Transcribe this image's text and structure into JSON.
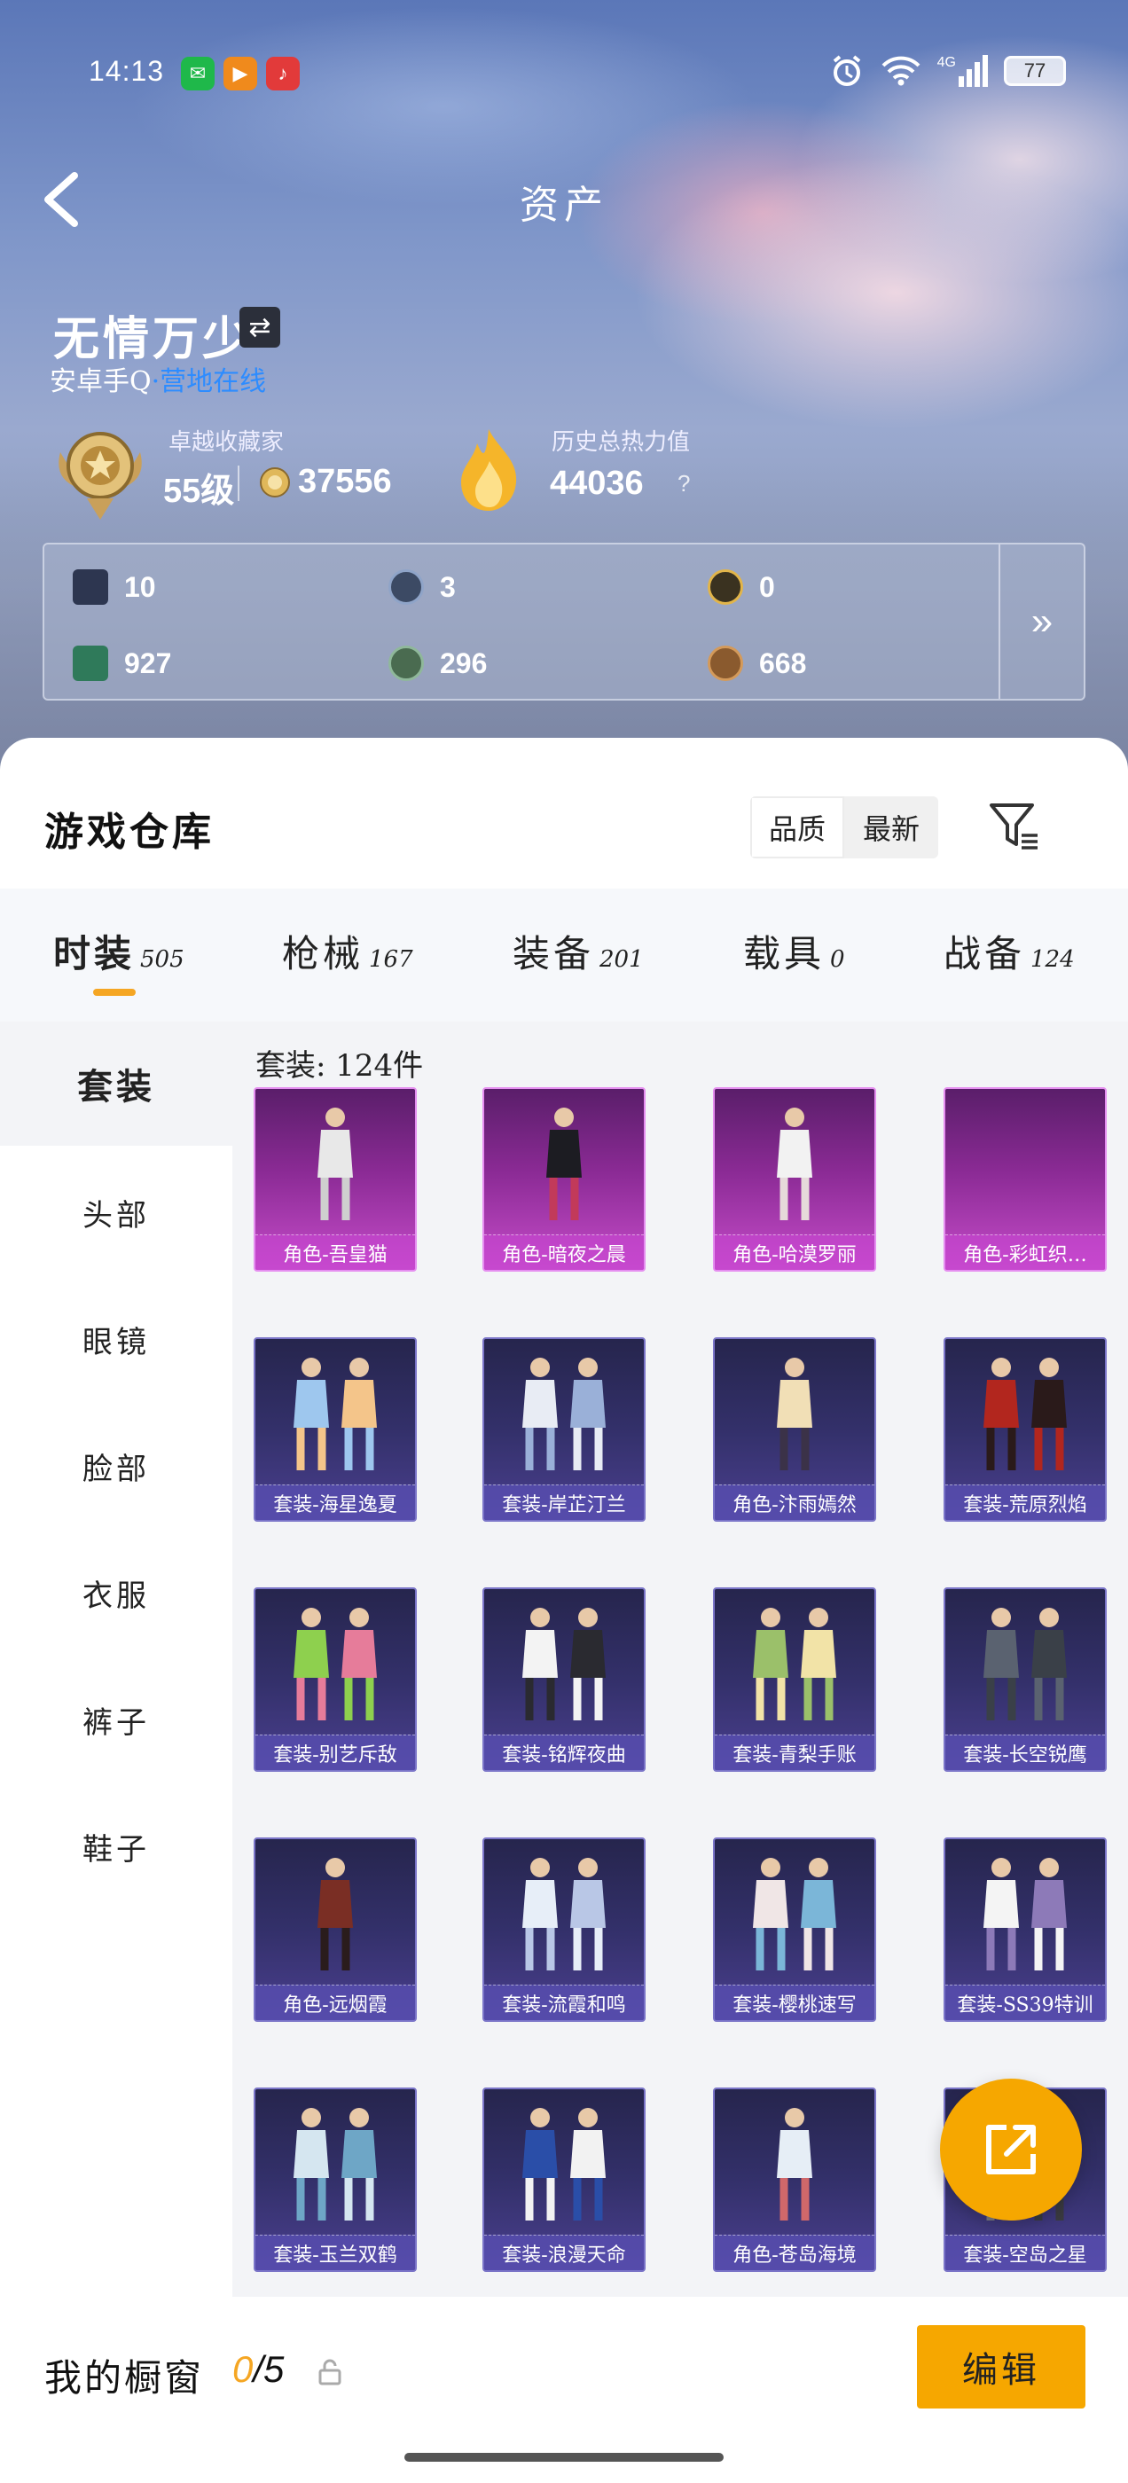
{
  "status_bar": {
    "time": "14:13",
    "network": "4G",
    "battery": "77"
  },
  "nav": {
    "title": "资产"
  },
  "player": {
    "name": "无情万少",
    "platform": "安卓手Q",
    "status": "·营地在线"
  },
  "stats": {
    "level_title": "卓越收藏家",
    "level": "55级",
    "points": "37556",
    "heat_title": "历史总热力值",
    "heat": "44036",
    "help": "?"
  },
  "stat_panel": {
    "row1": [
      "10",
      "3",
      "0"
    ],
    "row2": [
      "927",
      "296",
      "668"
    ],
    "more": "»"
  },
  "warehouse": {
    "title": "游戏仓库",
    "sort": [
      "品质",
      "最新"
    ]
  },
  "tabs": [
    {
      "label": "时装",
      "count": "505"
    },
    {
      "label": "枪械",
      "count": "167"
    },
    {
      "label": "装备",
      "count": "201"
    },
    {
      "label": "载具",
      "count": "0"
    },
    {
      "label": "战备",
      "count": "124"
    }
  ],
  "side_nav": [
    "套装",
    "头部",
    "眼镜",
    "脸部",
    "衣服",
    "裤子",
    "鞋子"
  ],
  "grid": {
    "count_label": "套装: 124件",
    "items": [
      {
        "name": "角色-吾皇猫",
        "colors": [
          "#e8e8e8",
          "#cfcfcf"
        ]
      },
      {
        "name": "角色-暗夜之晨",
        "colors": [
          "#1c1c22",
          "#c23a5a"
        ]
      },
      {
        "name": "角色-哈漠罗丽",
        "colors": [
          "#f2f2f2",
          "#e6dada"
        ]
      },
      {
        "name": "角色-彩虹织…",
        "colors": [
          "#6a2a7a",
          "#6a2a7a"
        ]
      },
      {
        "name": "套装-海星逸夏",
        "colors": [
          "#9ec7ee",
          "#f4c58a"
        ]
      },
      {
        "name": "套装-岸芷汀兰",
        "colors": [
          "#e8ecf4",
          "#9ab0d8"
        ]
      },
      {
        "name": "角色-汴雨嫣然",
        "colors": [
          "#f1dfb6",
          "#3b3248"
        ]
      },
      {
        "name": "套装-荒原烈焰",
        "colors": [
          "#b2261e",
          "#2a1a1a"
        ]
      },
      {
        "name": "套装-别艺斥敌",
        "colors": [
          "#8ed04e",
          "#e67c9a"
        ]
      },
      {
        "name": "套装-铭辉夜曲",
        "colors": [
          "#f3f3f3",
          "#2a2a30"
        ]
      },
      {
        "name": "套装-青梨手账",
        "colors": [
          "#9bc06a",
          "#f2e3a7"
        ]
      },
      {
        "name": "套装-长空锐鹰",
        "colors": [
          "#5a6270",
          "#3a4048"
        ]
      },
      {
        "name": "角色-远烟霞",
        "colors": [
          "#7a2e24",
          "#2a1c1c"
        ]
      },
      {
        "name": "套装-流霞和鸣",
        "colors": [
          "#e7eef8",
          "#b9c7e6"
        ]
      },
      {
        "name": "套装-樱桃速写",
        "colors": [
          "#f0e6e6",
          "#7bb6d8"
        ]
      },
      {
        "name": "套装-SS39特训",
        "colors": [
          "#f4f4f4",
          "#8d7ab8"
        ]
      },
      {
        "name": "套装-玉兰双鹤",
        "colors": [
          "#d5e6f0",
          "#6ea6c6"
        ]
      },
      {
        "name": "套装-浪漫天命",
        "colors": [
          "#2a4ea8",
          "#f2f2f2"
        ]
      },
      {
        "name": "角色-苍岛海境",
        "colors": [
          "#e6eef6",
          "#d0686a"
        ]
      },
      {
        "name": "套装-空岛之星",
        "colors": [
          "#3a3a40",
          "#7a7a80"
        ]
      }
    ]
  },
  "bottom": {
    "showcase_label": "我的橱窗",
    "showcase_current": "0",
    "showcase_total": "/5",
    "edit_label": "编辑"
  },
  "colors": {
    "accent": "#f6a700",
    "online": "#2d8cff",
    "card_pink": "#c54cc9",
    "card_purple": "#4a3f8e"
  }
}
